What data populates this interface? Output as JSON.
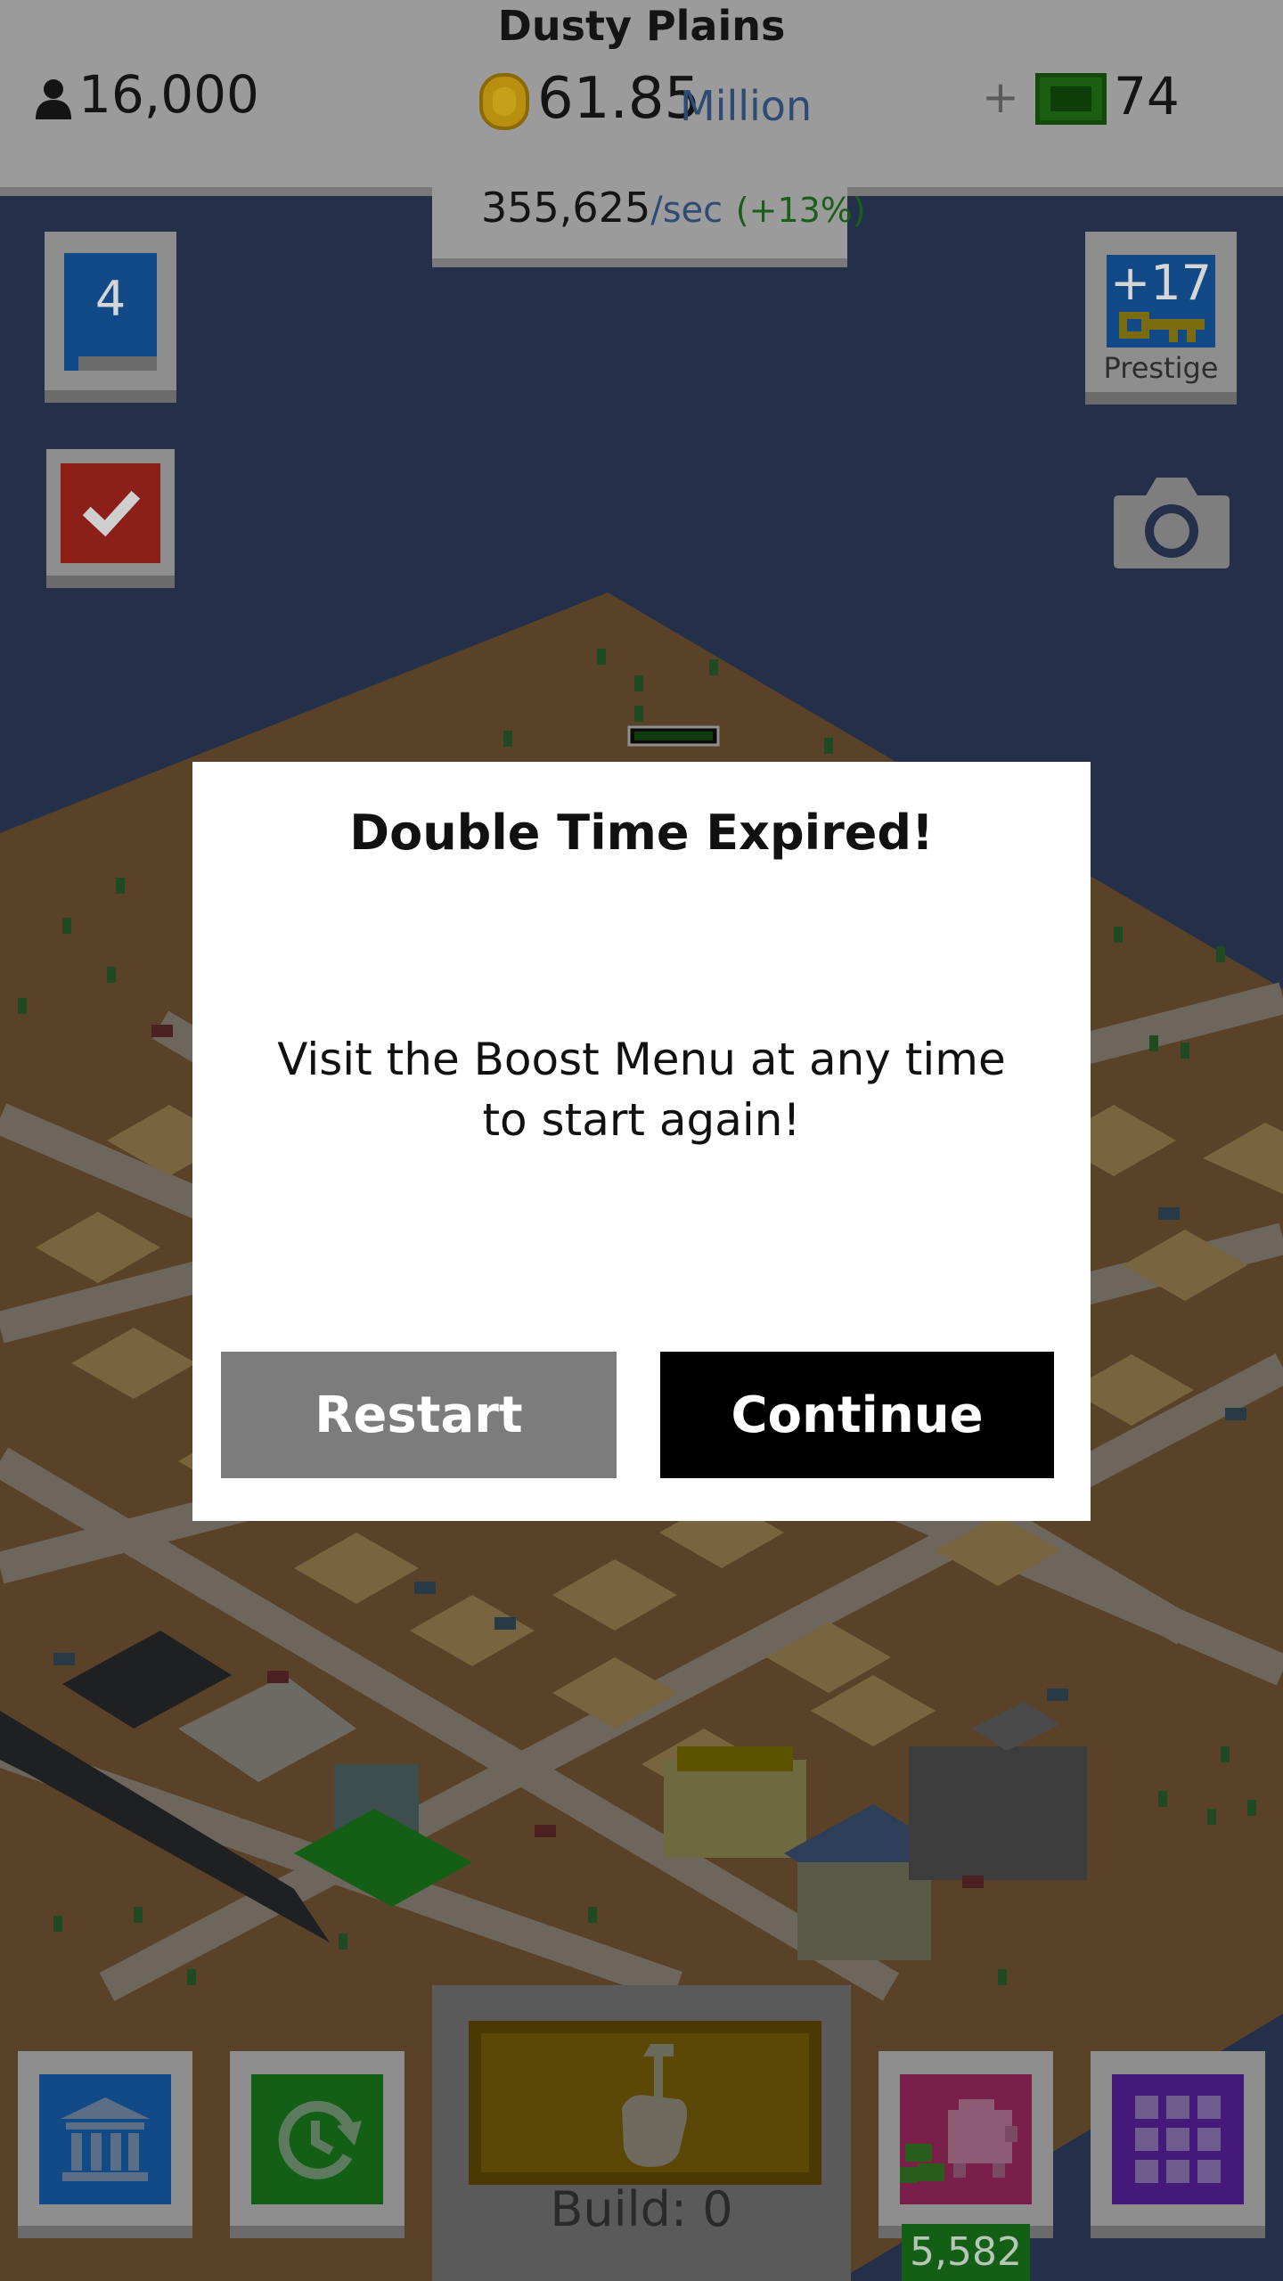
{
  "hud": {
    "city_name": "Dusty Plains",
    "population": "16,000",
    "money": "61.85",
    "money_unit": "Million",
    "plus": "+",
    "cash": "74",
    "rate": "355,625",
    "rate_unit": "/sec",
    "rate_bonus": "(+13%)"
  },
  "side_buttons": {
    "level": "4",
    "level_progress": 0.15,
    "prestige_value": "+17",
    "prestige_label": "Prestige"
  },
  "dialog": {
    "title": "Double Time Expired!",
    "message": "Visit the Boost Menu at any time to start again!",
    "restart_label": "Restart",
    "continue_label": "Continue"
  },
  "bottom": {
    "build_label": "Build: 0",
    "piggy_count": "5,582"
  },
  "icons": {
    "population": "person-icon",
    "money": "coin-icon",
    "cash": "cash-icon",
    "check": "checkmark-icon",
    "prestige": "key-icon",
    "camera": "camera-icon",
    "build": "hammer-hand-icon",
    "bank": "bank-icon",
    "boost": "clock-refresh-icon",
    "piggy": "piggy-bank-icon",
    "menu": "grid-menu-icon"
  },
  "colors": {
    "dialog_background": "#ffffff",
    "restart_button": "#7c7c7c",
    "continue_button": "#000000",
    "rate_bonus": "#1a5e1a"
  }
}
